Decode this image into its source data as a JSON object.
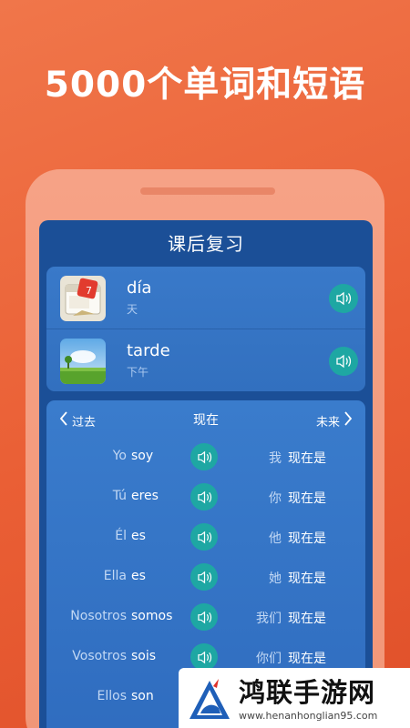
{
  "headline": "5000个单词和短语",
  "screen": {
    "title": "课后复习",
    "vocab": [
      {
        "word": "día",
        "translation": "天",
        "image_icon": "calendar-icon",
        "sound_icon": "speaker-icon"
      },
      {
        "word": "tarde",
        "translation": "下午",
        "image_icon": "landscape-icon",
        "sound_icon": "speaker-icon"
      }
    ],
    "tenses": {
      "prev": "过去",
      "current": "现在",
      "next": "未来"
    },
    "conjugations": [
      {
        "pronoun": "Yo",
        "verb": "soy",
        "cn_pronoun": "我",
        "cn_verb": "现在是"
      },
      {
        "pronoun": "Tú",
        "verb": "eres",
        "cn_pronoun": "你",
        "cn_verb": "现在是"
      },
      {
        "pronoun": "Él",
        "verb": "es",
        "cn_pronoun": "他",
        "cn_verb": "现在是"
      },
      {
        "pronoun": "Ella",
        "verb": "es",
        "cn_pronoun": "她",
        "cn_verb": "现在是"
      },
      {
        "pronoun": "Nosotros",
        "verb": "somos",
        "cn_pronoun": "我们",
        "cn_verb": "现在是"
      },
      {
        "pronoun": "Vosotros",
        "verb": "sois",
        "cn_pronoun": "你们",
        "cn_verb": "现在是"
      },
      {
        "pronoun": "Ellos",
        "verb": "son",
        "cn_pronoun": "",
        "cn_verb": ""
      }
    ]
  },
  "watermark": {
    "brand": "鸿联手游网",
    "url": "www.henanhonglian95.com"
  },
  "colors": {
    "background": "#ea5f35",
    "screen": "#1b4f97",
    "card": "#3574c5",
    "sound_button": "#1ea7a3"
  }
}
